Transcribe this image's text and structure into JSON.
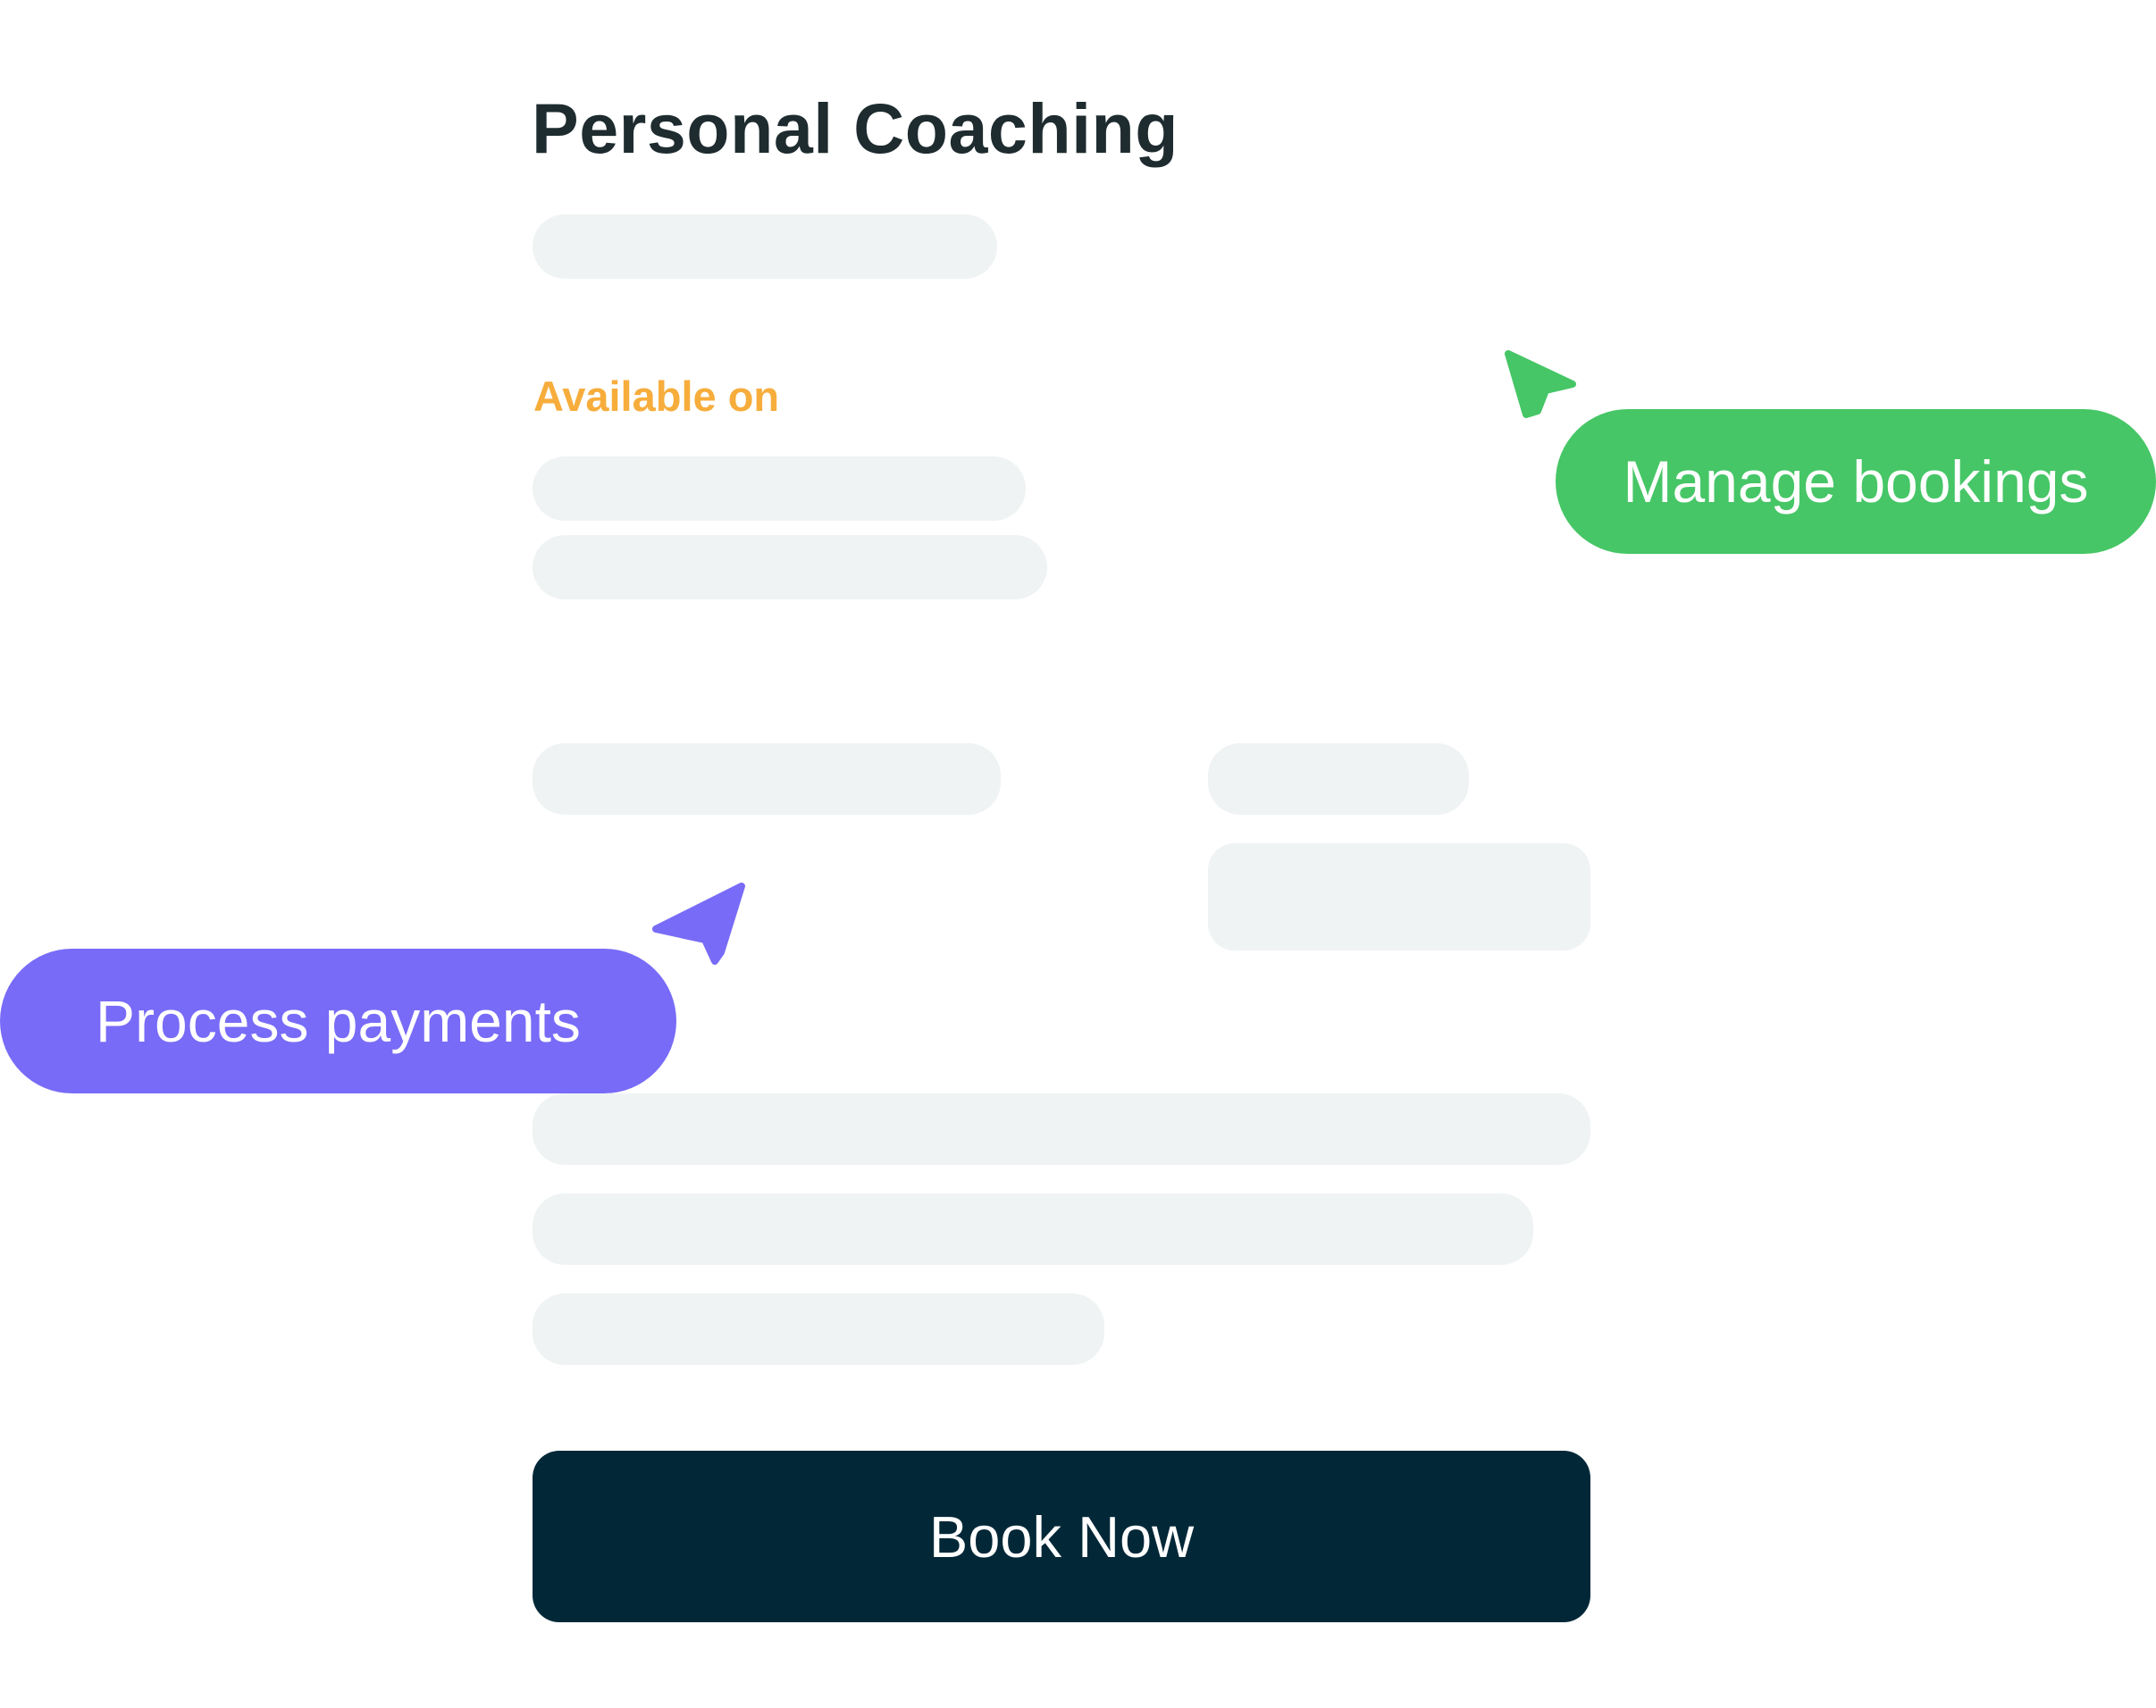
{
  "card": {
    "title": "Personal Coaching",
    "available_label": "Available on",
    "book_button_label": "Book Now"
  },
  "callouts": {
    "manage_bookings": "Manage bookings",
    "process_payments": "Process payments"
  },
  "icons": {
    "green_cursor": "cursor-arrow-icon",
    "purple_cursor": "cursor-arrow-icon"
  },
  "colors": {
    "title": "#1e2b2f",
    "available_label": "#f7ad3c",
    "placeholder": "#eff3f3",
    "button": "#022838",
    "manage_pill": "#46c666",
    "process_pill": "#786bf7"
  }
}
